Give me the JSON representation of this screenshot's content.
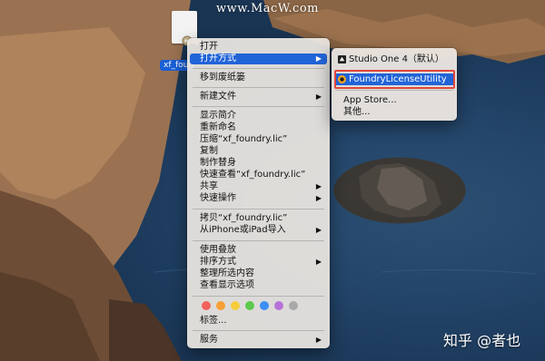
{
  "watermark": "www.MacW.com",
  "brand": "知乎 @者也",
  "desktop_file": {
    "label": "xf_foundry.lic"
  },
  "context_menu": {
    "items": [
      {
        "label": "打开"
      },
      {
        "label": "打开方式",
        "submenu": true,
        "active": true
      },
      {
        "label": "移到废纸篓"
      },
      {
        "label": "新建文件",
        "submenu": true
      },
      {
        "label": "显示简介"
      },
      {
        "label": "重新命名"
      },
      {
        "label": "压缩“xf_foundry.lic”"
      },
      {
        "label": "复制"
      },
      {
        "label": "制作替身"
      },
      {
        "label": "快速查看“xf_foundry.lic”"
      },
      {
        "label": "共享",
        "submenu": true
      },
      {
        "label": "快速操作",
        "submenu": true
      },
      {
        "label": "拷贝“xf_foundry.lic”"
      },
      {
        "label": "从iPhone或iPad导入",
        "submenu": true
      },
      {
        "label": "使用叠放"
      },
      {
        "label": "排序方式",
        "submenu": true
      },
      {
        "label": "整理所选内容"
      },
      {
        "label": "查看显示选项"
      },
      {
        "label": "标签..."
      },
      {
        "label": "服务",
        "submenu": true
      }
    ],
    "tag_colors": [
      "#f0625b",
      "#f7a035",
      "#f6cd3c",
      "#5bc94c",
      "#3c8ef6",
      "#b672d9",
      "#a9a9a9"
    ],
    "submenu_arrow": "▶"
  },
  "open_with_submenu": {
    "items": [
      {
        "label": "Studio One 4（默认）",
        "icon": "studio-one-icon"
      },
      {
        "label": "FoundryLicenseUtility",
        "icon": "foundry-icon",
        "active": true
      },
      {
        "label": "App Store..."
      },
      {
        "label": "其他..."
      }
    ]
  }
}
